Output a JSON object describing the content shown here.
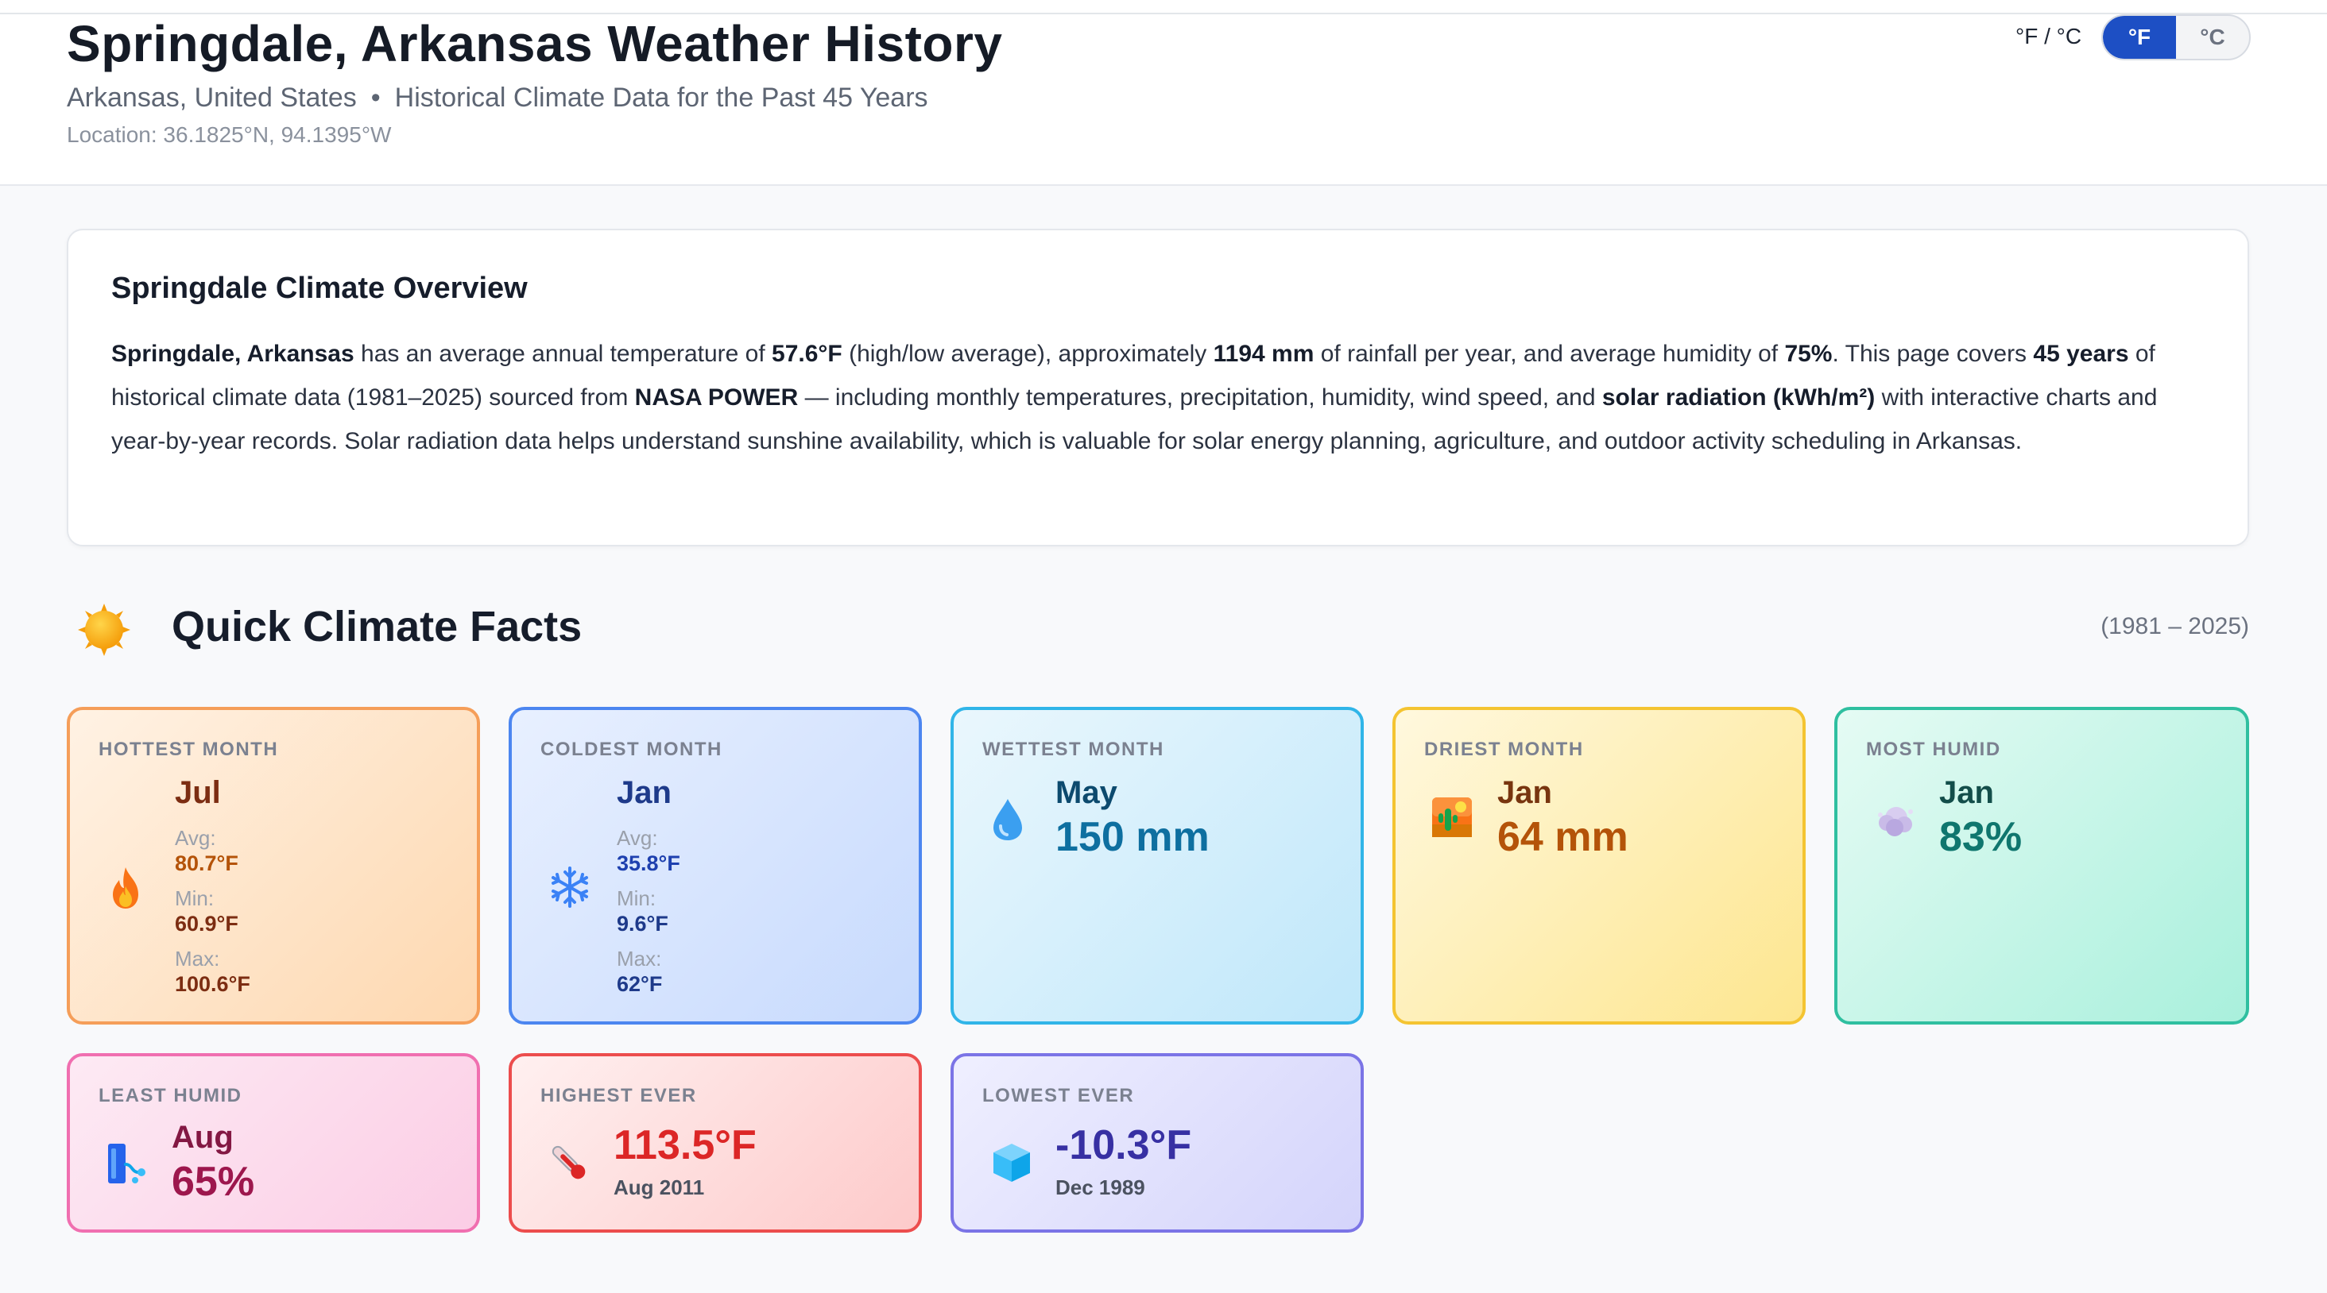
{
  "header": {
    "title": "Springdale, Arkansas Weather History",
    "region": "Arkansas, United States",
    "separator": "•",
    "tagline": "Historical Climate Data for the Past 45 Years",
    "location": "Location: 36.1825°N, 94.1395°W"
  },
  "units": {
    "label": "°F / °C",
    "fahrenheit": "°F",
    "celsius": "°C",
    "selected": "°F"
  },
  "overview": {
    "heading": "Springdale Climate Overview",
    "parts": {
      "city": "Springdale, Arkansas",
      "t1": " has an average annual temperature of ",
      "avg_temp": "57.6°F",
      "t2": " (high/low average), approximately ",
      "rainfall": "1194 mm",
      "t3": " of rainfall per year, and average humidity of ",
      "humidity": "75%",
      "t4": ". This page covers ",
      "years": "45 years",
      "t5": " of historical climate data (1981–2025) sourced from ",
      "source": "NASA POWER",
      "t6": " — including monthly temperatures, precipitation, humidity, wind speed, and ",
      "solar": "solar radiation (kWh/m²)",
      "t7": " with interactive charts and year-by-year records. Solar radiation data helps understand sunshine availability, which is valuable for solar energy planning, agriculture, and outdoor activity scheduling in Arkansas."
    }
  },
  "facts": {
    "title": "Quick Climate Facts",
    "range": "(1981 – 2025)",
    "hottest": {
      "label": "HOTTEST MONTH",
      "icon": "fire-icon",
      "month": "Jul",
      "avg_label": "Avg:",
      "avg": "80.7°F",
      "min_label": "Min:",
      "min": "60.9°F",
      "max_label": "Max:",
      "max": "100.6°F",
      "color": "#b45309"
    },
    "coldest": {
      "label": "COLDEST MONTH",
      "icon": "snowflake-icon",
      "month": "Jan",
      "avg_label": "Avg:",
      "avg": "35.8°F",
      "min_label": "Min:",
      "min": "9.6°F",
      "max_label": "Max:",
      "max": "62°F",
      "color": "#1e40af"
    },
    "wettest": {
      "label": "WETTEST MONTH",
      "icon": "droplet-icon",
      "month": "May",
      "value": "150 mm",
      "color": "#0e6fa0"
    },
    "driest": {
      "label": "DRIEST MONTH",
      "icon": "desert-icon",
      "month": "Jan",
      "value": "64 mm",
      "color": "#b45309"
    },
    "most_humid": {
      "label": "MOST HUMID",
      "icon": "cloud-icon",
      "month": "Jan",
      "value": "83%",
      "color": "#0f766e"
    },
    "least_humid": {
      "label": "LEAST HUMID",
      "icon": "dry-air-icon",
      "month": "Aug",
      "value": "65%",
      "color": "#9d174d"
    },
    "highest": {
      "label": "HIGHEST EVER",
      "icon": "thermometer-icon",
      "value": "113.5°F",
      "date": "Aug 2011",
      "color": "#dc2626"
    },
    "lowest": {
      "label": "LOWEST EVER",
      "icon": "ice-cube-icon",
      "value": "-10.3°F",
      "date": "Dec 1989",
      "color": "#3730a3"
    }
  }
}
